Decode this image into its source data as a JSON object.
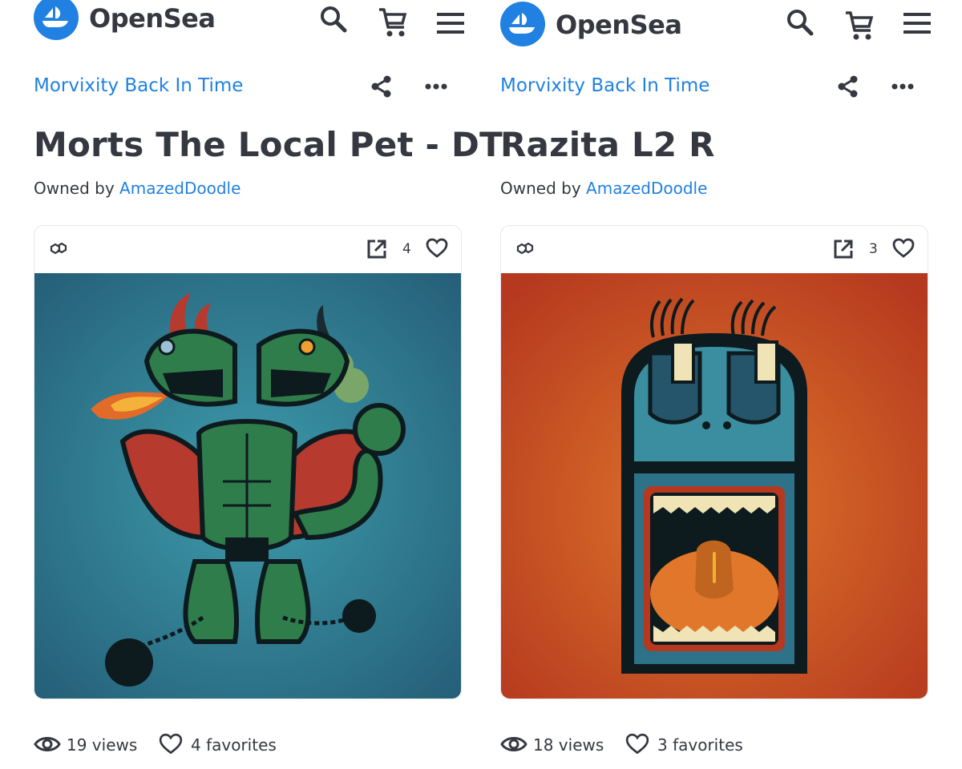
{
  "brand": "OpenSea",
  "items": [
    {
      "collection": "Morvixity Back In Time",
      "title": "Morts The Local Pet - DT",
      "owned_prefix": "Owned by",
      "owner": "AmazedDoodle",
      "favorite_count": "4",
      "views": "19 views",
      "favorites": "4 favorites",
      "image_description": "Two-headed green dragon creature with horns and bat wings breathing fire, chained to iron balls, on teal background"
    },
    {
      "collection": "Morvixity Back In Time",
      "title": "Razita L2 R",
      "owned_prefix": "Owned by",
      "owner": "AmazedDoodle",
      "favorite_count": "3",
      "views": "18 views",
      "favorites": "3 favorites",
      "image_description": "Tall blue character with closed eyelashed eyes and a wide open mouth showing teeth and a tongue, on orange-red background"
    }
  ],
  "icons": {
    "logo": "opensea-logo-icon",
    "search": "search-icon",
    "cart": "cart-icon",
    "menu": "menu-icon",
    "share": "share-icon",
    "more": "more-icon",
    "chain": "polygon-chain-icon",
    "external": "external-link-icon",
    "heart": "heart-icon",
    "eye": "eye-icon"
  },
  "colors": {
    "accent": "#2081e2",
    "text": "#353840",
    "border": "#e5e8eb",
    "art1_bg": "#2e6f86",
    "art2_bg": "#c04a22"
  }
}
